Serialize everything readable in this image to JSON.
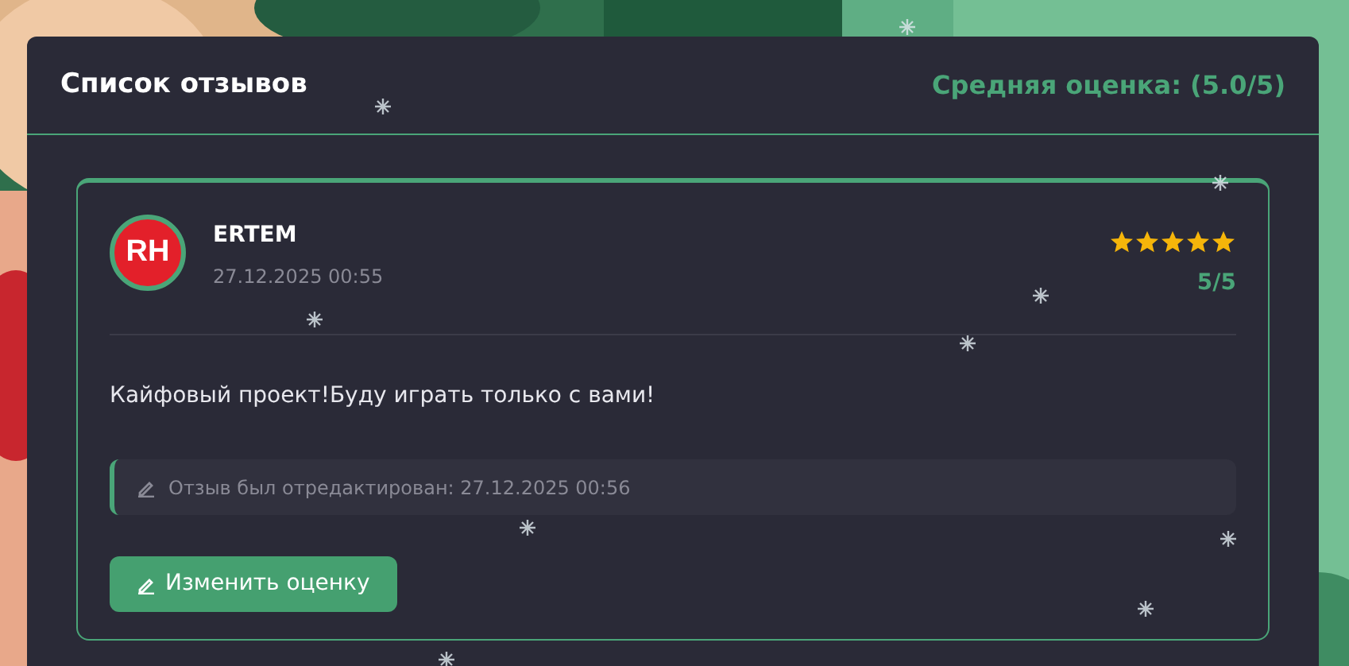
{
  "header": {
    "title": "Список отзывов",
    "average": "Средняя оценка: (5.0/5)"
  },
  "reviews": [
    {
      "avatar": "RH",
      "author": "ERTEM",
      "date": "27.12.2025 00:55",
      "stars": 5,
      "score": "5/5",
      "text": "Кайфовый проект!Буду играть только с вами!",
      "edited_note": "Отзыв был отредактирован: 27.12.2025 00:56",
      "button": "Изменить оценку"
    }
  ]
}
